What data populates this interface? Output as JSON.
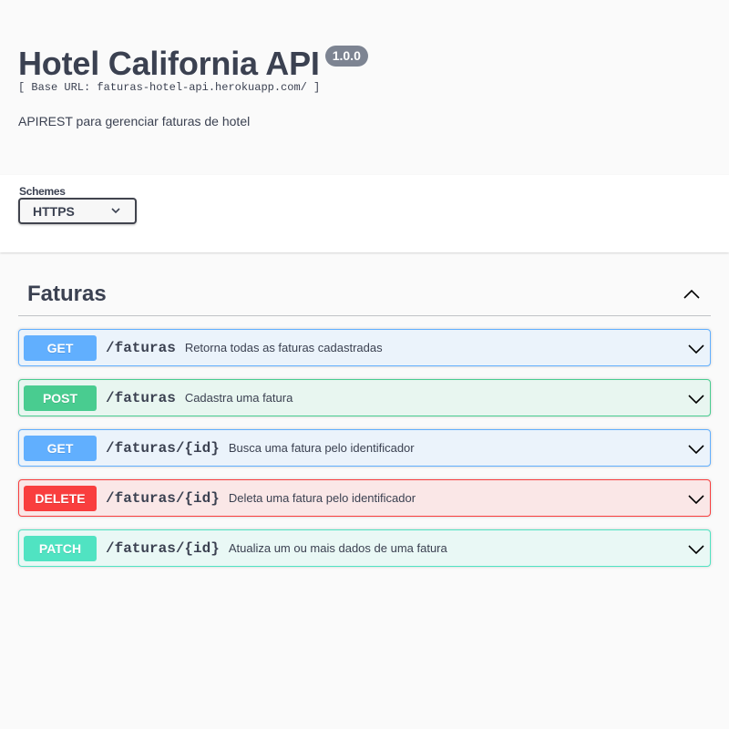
{
  "info": {
    "title": "Hotel California API",
    "version": "1.0.0",
    "base_url": "[ Base URL: faturas-hotel-api.herokuapp.com/ ]",
    "description": "APIREST para gerenciar faturas de hotel"
  },
  "schemes": {
    "label": "Schemes",
    "selected": "HTTPS"
  },
  "section": {
    "title": "Faturas",
    "operations": [
      {
        "method": "GET",
        "path": "/faturas",
        "summary": "Retorna todas as faturas cadastradas"
      },
      {
        "method": "POST",
        "path": "/faturas",
        "summary": "Cadastra uma fatura"
      },
      {
        "method": "GET",
        "path": "/faturas/{id}",
        "summary": "Busca uma fatura pelo identificador"
      },
      {
        "method": "DELETE",
        "path": "/faturas/{id}",
        "summary": "Deleta uma fatura pelo identificador"
      },
      {
        "method": "PATCH",
        "path": "/faturas/{id}",
        "summary": "Atualiza um ou mais dados de uma fatura"
      }
    ]
  },
  "colors": {
    "get": "#61affe",
    "post": "#49cc90",
    "delete": "#f93e3e",
    "patch": "#50e3c2",
    "text": "#3b4151"
  },
  "icons": {
    "scheme_dropdown": "chevron-down-icon",
    "section_toggle": "chevron-up-icon",
    "operation_expand": "chevron-down-icon"
  }
}
